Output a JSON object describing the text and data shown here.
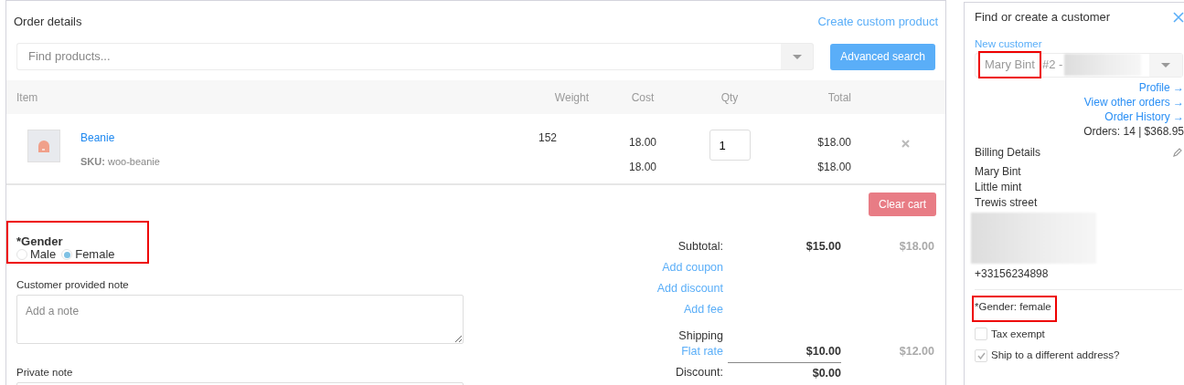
{
  "order_details": {
    "title": "Order details",
    "create_link": "Create custom product",
    "search": {
      "placeholder": "Find products..."
    },
    "advanced_search_button": "Advanced search",
    "table": {
      "columns": [
        "Item",
        "Weight",
        "Cost",
        "Qty",
        "Total"
      ],
      "rows": [
        {
          "name": "Beanie",
          "sku_label": "SKU:",
          "sku": "woo-beanie",
          "weight": "152",
          "cost_lines": [
            "18.00",
            "18.00"
          ],
          "qty": "1",
          "total_lines": [
            "$18.00",
            "$18.00"
          ]
        }
      ]
    },
    "clear_cart_button": "Clear cart",
    "gender_field": {
      "label": "*Gender",
      "highlighted": true,
      "options": [
        {
          "label": "Male",
          "selected": false
        },
        {
          "label": "Female",
          "selected": true
        }
      ]
    },
    "customer_note": {
      "label": "Customer provided note",
      "placeholder": "Add a note"
    },
    "private_note": {
      "label": "Private note"
    },
    "totals": [
      {
        "kind": "amount",
        "label": "Subtotal:",
        "value": "$15.00",
        "original": "$18.00"
      },
      {
        "kind": "link",
        "label": "Add coupon"
      },
      {
        "kind": "link",
        "label": "Add discount"
      },
      {
        "kind": "link",
        "label": "Add fee"
      },
      {
        "kind": "heading",
        "label": "Shipping"
      },
      {
        "kind": "amount_link",
        "label": "Flat rate",
        "value": "$10.00",
        "original": "$12.00"
      },
      {
        "kind": "amount",
        "label": "Discount:",
        "value": "$0.00",
        "divider_above": true
      }
    ]
  },
  "customer_panel": {
    "title": "Find or create a customer",
    "new_customer_link": "New customer",
    "customer_select": {
      "name": "Mary Bint",
      "name_highlighted": true,
      "suffix": "#2 -"
    },
    "links": [
      "Profile →",
      "View other orders →",
      "Order History →"
    ],
    "orders_summary": "Orders: 14 | $368.95",
    "billing": {
      "title": "Billing Details",
      "lines": [
        "Mary Bint",
        "Little mint",
        "Trewis street"
      ],
      "phone": "+33156234898"
    },
    "gender_info": {
      "text": "*Gender: female",
      "highlighted": true
    },
    "checkboxes": [
      {
        "label": "Tax exempt",
        "checked": false
      },
      {
        "label": "Ship to a different address?",
        "checked": true
      }
    ]
  }
}
